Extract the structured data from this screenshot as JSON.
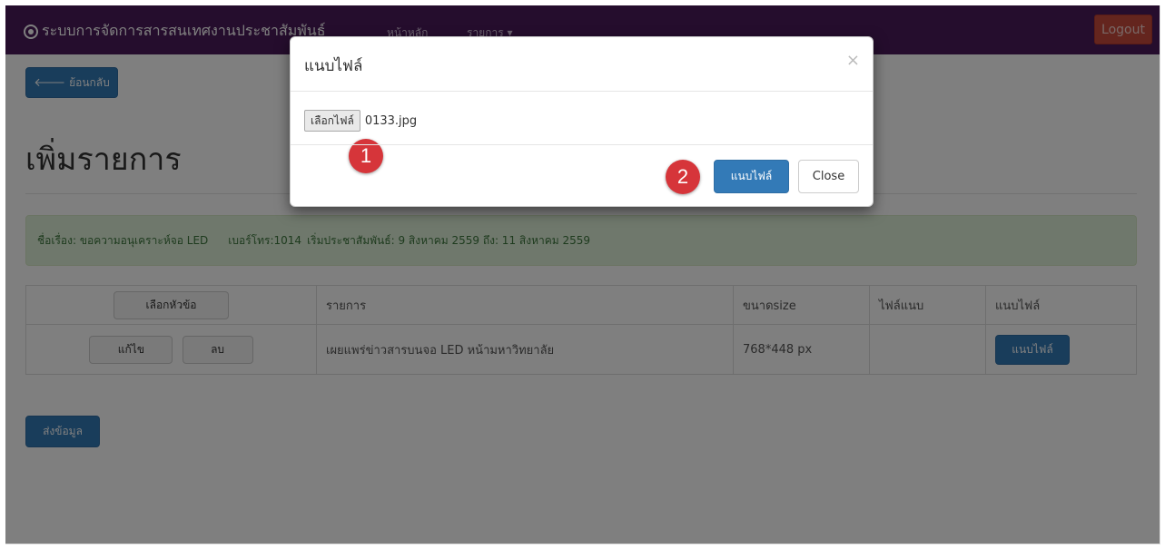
{
  "navbar": {
    "brand": "ระบบการจัดการสารสนเทศงานประชาสัมพันธ์",
    "nav_home": "หน้าหลัก",
    "nav_list": "รายการ ▾",
    "logout": "Logout"
  },
  "page": {
    "back_label": "ย้อนกลับ",
    "title": "เพิ่มรายการ",
    "info": {
      "subject": "ชื่อเรื่อง: ขอความอนุเคราะห์จอ LED",
      "phone": "เบอร์โทร:1014",
      "dates": "เริ่มประชาสัมพันธ์: 9 สิงหาคม 2559 ถึง: 11 สิงหาคม 2559"
    },
    "table": {
      "select_topic": "เลือกหัวข้อ",
      "headers": [
        "รายการ",
        "ขนาดsize",
        "ไฟล์แนบ",
        "แนบไฟล์"
      ],
      "row": {
        "edit": "แก้ไข",
        "delete": "ลบ",
        "item": "เผยแพร่ข่าวสารบนจอ LED หน้ามหาวิทยาลัย",
        "size": "768*448 px",
        "attachment": "",
        "attach_button": "แนบไฟล์"
      }
    },
    "submit": "ส่งข้อมูล"
  },
  "modal": {
    "title": "แนบไฟล์",
    "close_x": "×",
    "choose_file": "เลือกไฟล์",
    "file_name": "0133.jpg",
    "attach": "แนบไฟล์",
    "close": "Close"
  },
  "markers": [
    "1",
    "2"
  ],
  "colors": {
    "navbar": "#4a1a5a",
    "primary": "#337ab7",
    "logout": "#c94a3c",
    "marker": "#d6353a",
    "info_bg": "#dff0d8"
  }
}
